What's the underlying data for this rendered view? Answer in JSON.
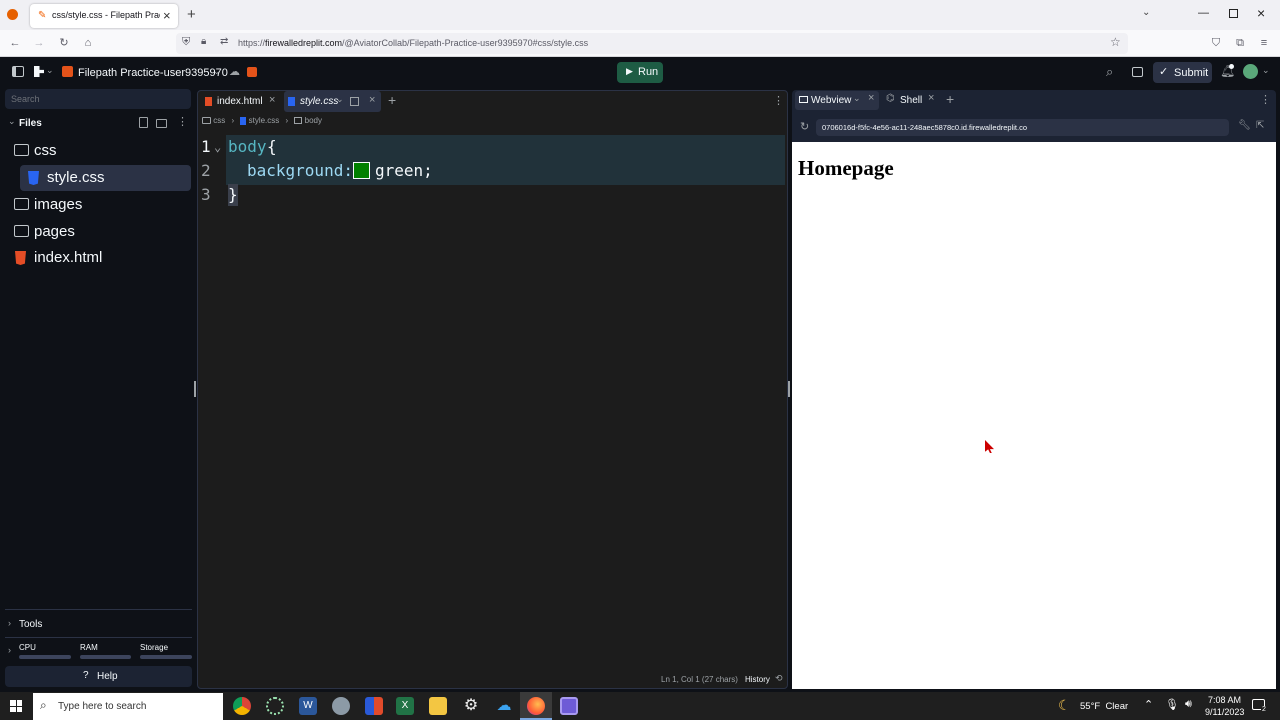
{
  "browser": {
    "tab_title": "css/style.css - Filepath Practice",
    "tab_close": "×",
    "new_tab": "+",
    "url_prefix": "https://",
    "url_host": "firewalledreplit.com",
    "url_rest": "/@AviatorCollab/Filepath-Practice-user9395970#css/style.css"
  },
  "replit": {
    "project_name": "Filepath Practice-user9395970",
    "run_label": "Run",
    "submit_label": "Submit"
  },
  "sidebar": {
    "search_placeholder": "Search",
    "files_label": "Files",
    "items": [
      {
        "label": "css"
      },
      {
        "label": "style.css"
      },
      {
        "label": "images"
      },
      {
        "label": "pages"
      },
      {
        "label": "index.html"
      }
    ],
    "tools_label": "Tools",
    "cpu_label": "CPU",
    "ram_label": "RAM",
    "storage_label": "Storage",
    "help_label": "Help"
  },
  "editor": {
    "tabs": [
      {
        "label": "index.html"
      },
      {
        "label": "style.css"
      }
    ],
    "breadcrumb": [
      "css",
      "style.css",
      "body"
    ],
    "lines": [
      {
        "num": "1",
        "selector": "body",
        "brace": "{"
      },
      {
        "num": "2",
        "prop": "background:",
        "value": "green;"
      },
      {
        "num": "3",
        "brace": "}"
      }
    ],
    "swatch_color": "#008000",
    "status_pos": "Ln 1, Col 1 (27 chars)",
    "history_label": "History"
  },
  "webview": {
    "tabs": [
      {
        "label": "Webview"
      },
      {
        "label": "Shell"
      }
    ],
    "url": "0706016d-f5fc-4e56-ac11-248aec5878c0.id.firewalledreplit.co",
    "heading": "Homepage"
  },
  "taskbar": {
    "search_placeholder": "Type here to search",
    "weather": "55°F  Clear",
    "time": "7:08 AM",
    "date": "9/11/2023",
    "notif_count": "2"
  }
}
